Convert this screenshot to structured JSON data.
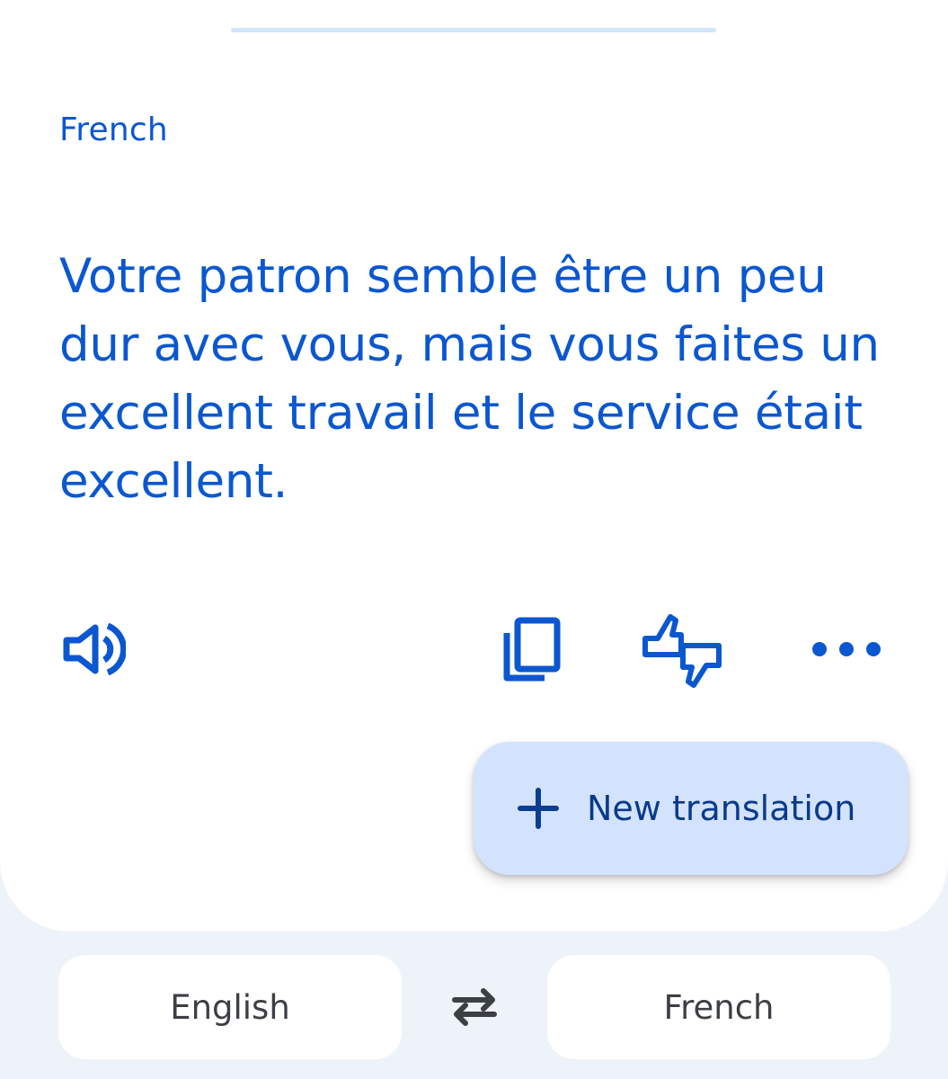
{
  "result": {
    "language_label": "French",
    "text": "Votre patron semble être un peu dur avec vous, mais vous faites un excellent travail et le service était excellent."
  },
  "actions": {
    "listen_icon": "speaker-icon",
    "copy_icon": "copy-icon",
    "feedback_icon": "thumbs-up-down-icon",
    "more_icon": "more-horizontal-icon"
  },
  "fab": {
    "label": "New translation",
    "icon": "plus-icon"
  },
  "language_bar": {
    "source": "English",
    "target": "French",
    "swap_icon": "swap-arrows-icon"
  },
  "colors": {
    "accent": "#0b57d0",
    "fab_background": "#d3e3fd",
    "page_background": "#eef2f9"
  }
}
